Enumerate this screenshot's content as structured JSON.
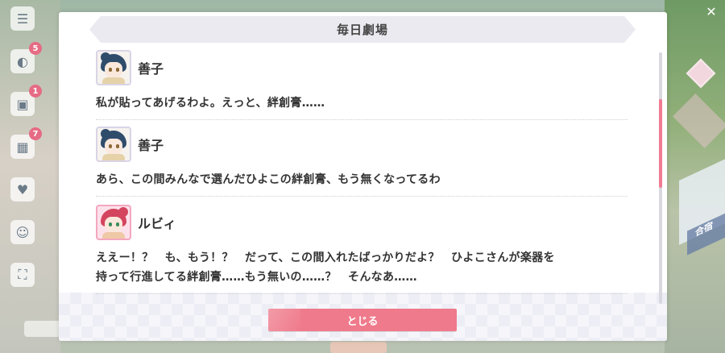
{
  "modal": {
    "title": "毎日劇場",
    "close_label": "とじる"
  },
  "entries": [
    {
      "speaker": "善子",
      "avatar": "yoshiko-avatar",
      "text": "私が貼ってあげるわよ。えっと、絆創膏……"
    },
    {
      "speaker": "善子",
      "avatar": "yoshiko-avatar",
      "text": "あら、この間みんなで選んだひよこの絆創膏、もう無くなってるわ"
    },
    {
      "speaker": "ルビィ",
      "avatar": "ruby-avatar",
      "text_line1": "ええー！？　も、もう！？　だって、この間入れたばっかりだよ？　ひよこさんが楽器を",
      "text_line2": "持って行進してる絆創膏……もう無いの……？　そんなあ……"
    }
  ],
  "side_menu": {
    "badges": [
      "5",
      "1",
      "7"
    ]
  },
  "background": {
    "label": "合宿"
  },
  "colors": {
    "accent": "#ef7a8b",
    "scroll_thumb": "#f07b92",
    "title_bar": "#eaeaf0",
    "badge": "#e66b84"
  }
}
